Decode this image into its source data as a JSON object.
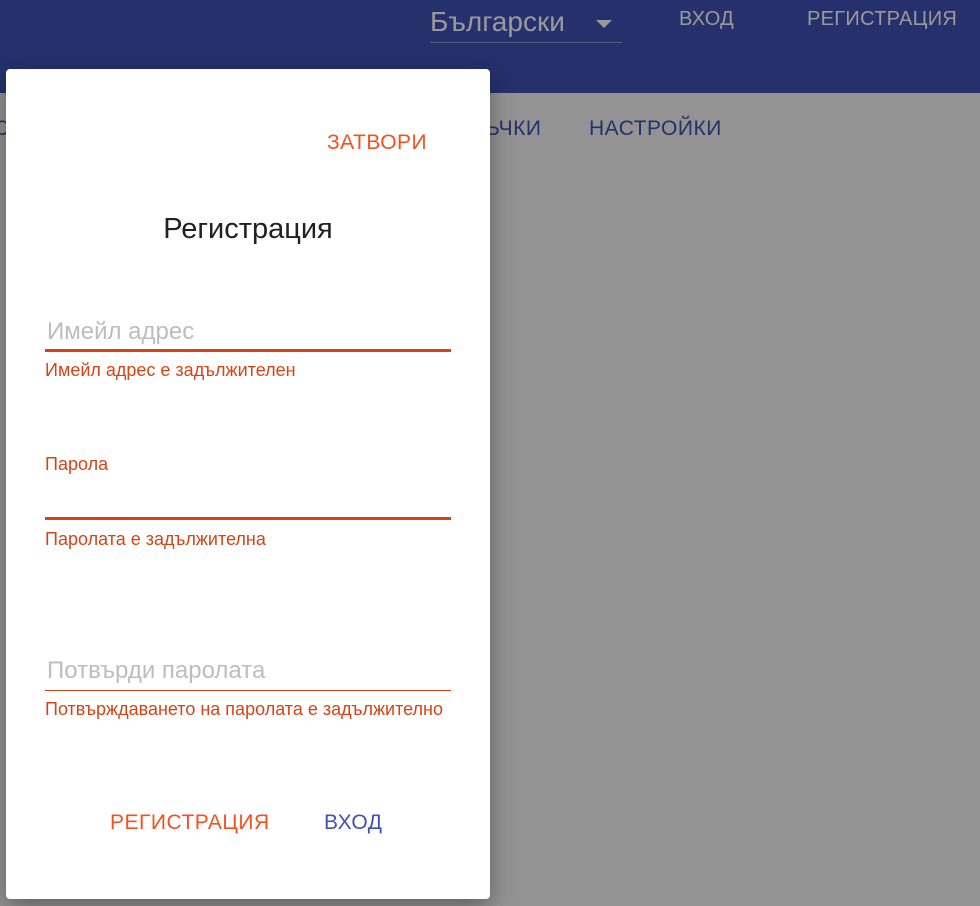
{
  "header": {
    "language": "Български",
    "login_link": "ВХОД",
    "register_link": "РЕГИСТРАЦИЯ"
  },
  "nav": {
    "partial_left": "О",
    "partial_tab": "ЬЧКИ",
    "settings_tab": "НАСТРОЙКИ"
  },
  "dialog": {
    "close_label": "ЗАТВОРИ",
    "title": "Регистрация",
    "email": {
      "placeholder": "Имейл адрес",
      "value": "",
      "error": "Имейл адрес е задължителен"
    },
    "password": {
      "label": "Парола",
      "value": "",
      "error": "Паролата е задължителна"
    },
    "confirm": {
      "placeholder": "Потвърди паролата",
      "value": "",
      "error": "Потвърждаването на паролата е задължително"
    },
    "register_button": "РЕГИСТРАЦИЯ",
    "login_button": "ВХОД"
  },
  "colors": {
    "primary": "#3f51b5",
    "accent": "#f4511e",
    "error": "#d84315"
  }
}
